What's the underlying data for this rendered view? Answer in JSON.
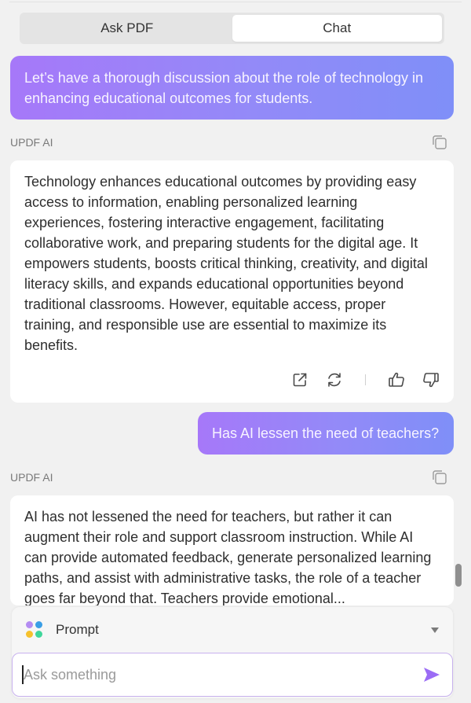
{
  "tabs": [
    {
      "label": "Ask PDF",
      "active": false
    },
    {
      "label": "Chat",
      "active": true
    }
  ],
  "messages": [
    {
      "role": "user",
      "text": "Let’s have a thorough discussion about the role of technology in enhancing educational outcomes for students."
    },
    {
      "role": "assistant",
      "sender_label": "UPDF AI",
      "text": "Technology enhances educational outcomes by providing easy access to information, enabling personalized learning experiences, fostering interactive engagement, facilitating collaborative work, and preparing students for the digital age. It empowers students, boosts critical thinking, creativity, and digital literacy skills, and expands educational opportunities beyond traditional classrooms. However, equitable access, proper training, and responsible use are essential to maximize its benefits.",
      "actions": [
        "open-external-icon",
        "regenerate-icon",
        "thumbs-up-icon",
        "thumbs-down-icon"
      ]
    },
    {
      "role": "user",
      "text": "Has AI lessen the need of teachers?"
    },
    {
      "role": "assistant",
      "sender_label": "UPDF AI",
      "text": "AI has not lessened the need for teachers, but rather it can augment their role and support classroom instruction. While AI can provide automated feedback, generate personalized learning paths, and assist with administrative tasks, the role of a teacher goes far beyond that. Teachers provide emotional..."
    }
  ],
  "composer": {
    "prompt_label": "Prompt",
    "input_value": "",
    "input_placeholder": "Ask something"
  },
  "colors": {
    "accent": "#9b6cf5",
    "user_bubble_start": "#a678f9",
    "user_bubble_end": "#7f8ff8",
    "prompt_dots": [
      "#b48cf2",
      "#3a9ee6",
      "#f6c12d",
      "#3fd69b"
    ]
  }
}
